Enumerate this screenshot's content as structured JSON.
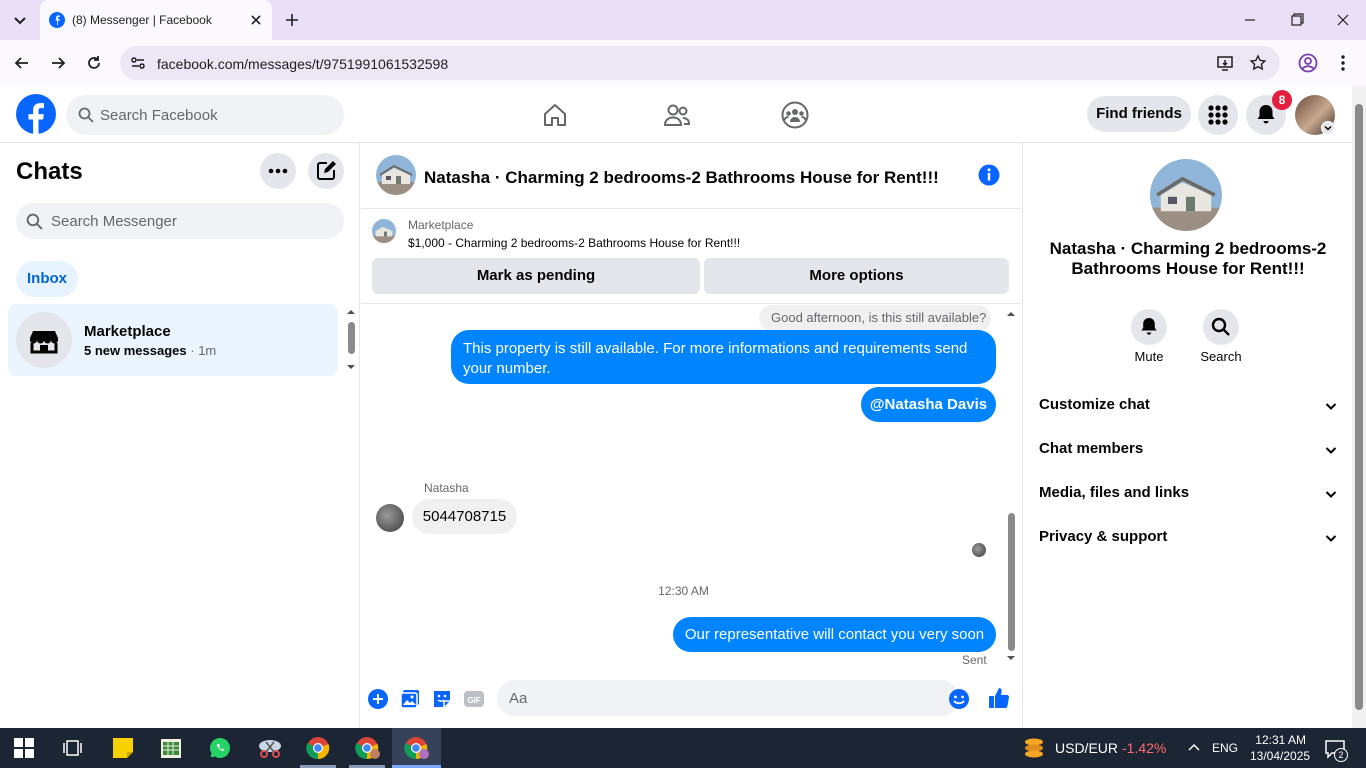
{
  "browser": {
    "tab_title": "(8) Messenger | Facebook",
    "url": "facebook.com/messages/t/9751991061532598"
  },
  "header": {
    "search_placeholder": "Search Facebook",
    "find_friends": "Find friends",
    "notification_count": "8"
  },
  "sidebar": {
    "title": "Chats",
    "search_placeholder": "Search Messenger",
    "inbox_label": "Inbox",
    "chats": [
      {
        "name": "Marketplace",
        "preview": "5 new messages",
        "time": "· 1m"
      }
    ]
  },
  "conversation": {
    "title": "Natasha · Charming 2 bedrooms-2 Bathrooms House for Rent!!!",
    "marketplace_label": "Marketplace",
    "listing": "$1,000 - Charming 2 bedrooms-2 Bathrooms House for Rent!!!",
    "mark_pending": "Mark as pending",
    "more_options": "More options",
    "quoted_message": "Good afternoon, is this still available?",
    "messages": [
      {
        "from": "me",
        "text": "This property is still available. For more informations and requirements send your number."
      },
      {
        "from": "me",
        "text": "@Natasha Davis"
      },
      {
        "from": "Natasha",
        "sender_label": "Natasha",
        "text": "5044708715"
      },
      {
        "from": "me",
        "text": "Our representative will contact you very soon"
      }
    ],
    "timestamp": "12:30 AM",
    "status": "Sent",
    "composer_placeholder": "Aa"
  },
  "info_panel": {
    "name": "Natasha · Charming 2 bedrooms-2 Bathrooms House for Rent!!!",
    "actions": [
      {
        "label": "Mute",
        "icon": "bell-icon"
      },
      {
        "label": "Search",
        "icon": "search-icon"
      }
    ],
    "sections": [
      "Customize chat",
      "Chat members",
      "Media, files and links",
      "Privacy & support"
    ]
  },
  "taskbar": {
    "currency_pair": "USD/EUR",
    "currency_change": "-1.42%",
    "language": "ENG",
    "time": "12:31 AM",
    "date": "13/04/2025",
    "notification_count": "2"
  },
  "colors": {
    "messenger_blue": "#0084ff",
    "fb_blue": "#0866ff",
    "badge_red": "#e41e3f"
  }
}
